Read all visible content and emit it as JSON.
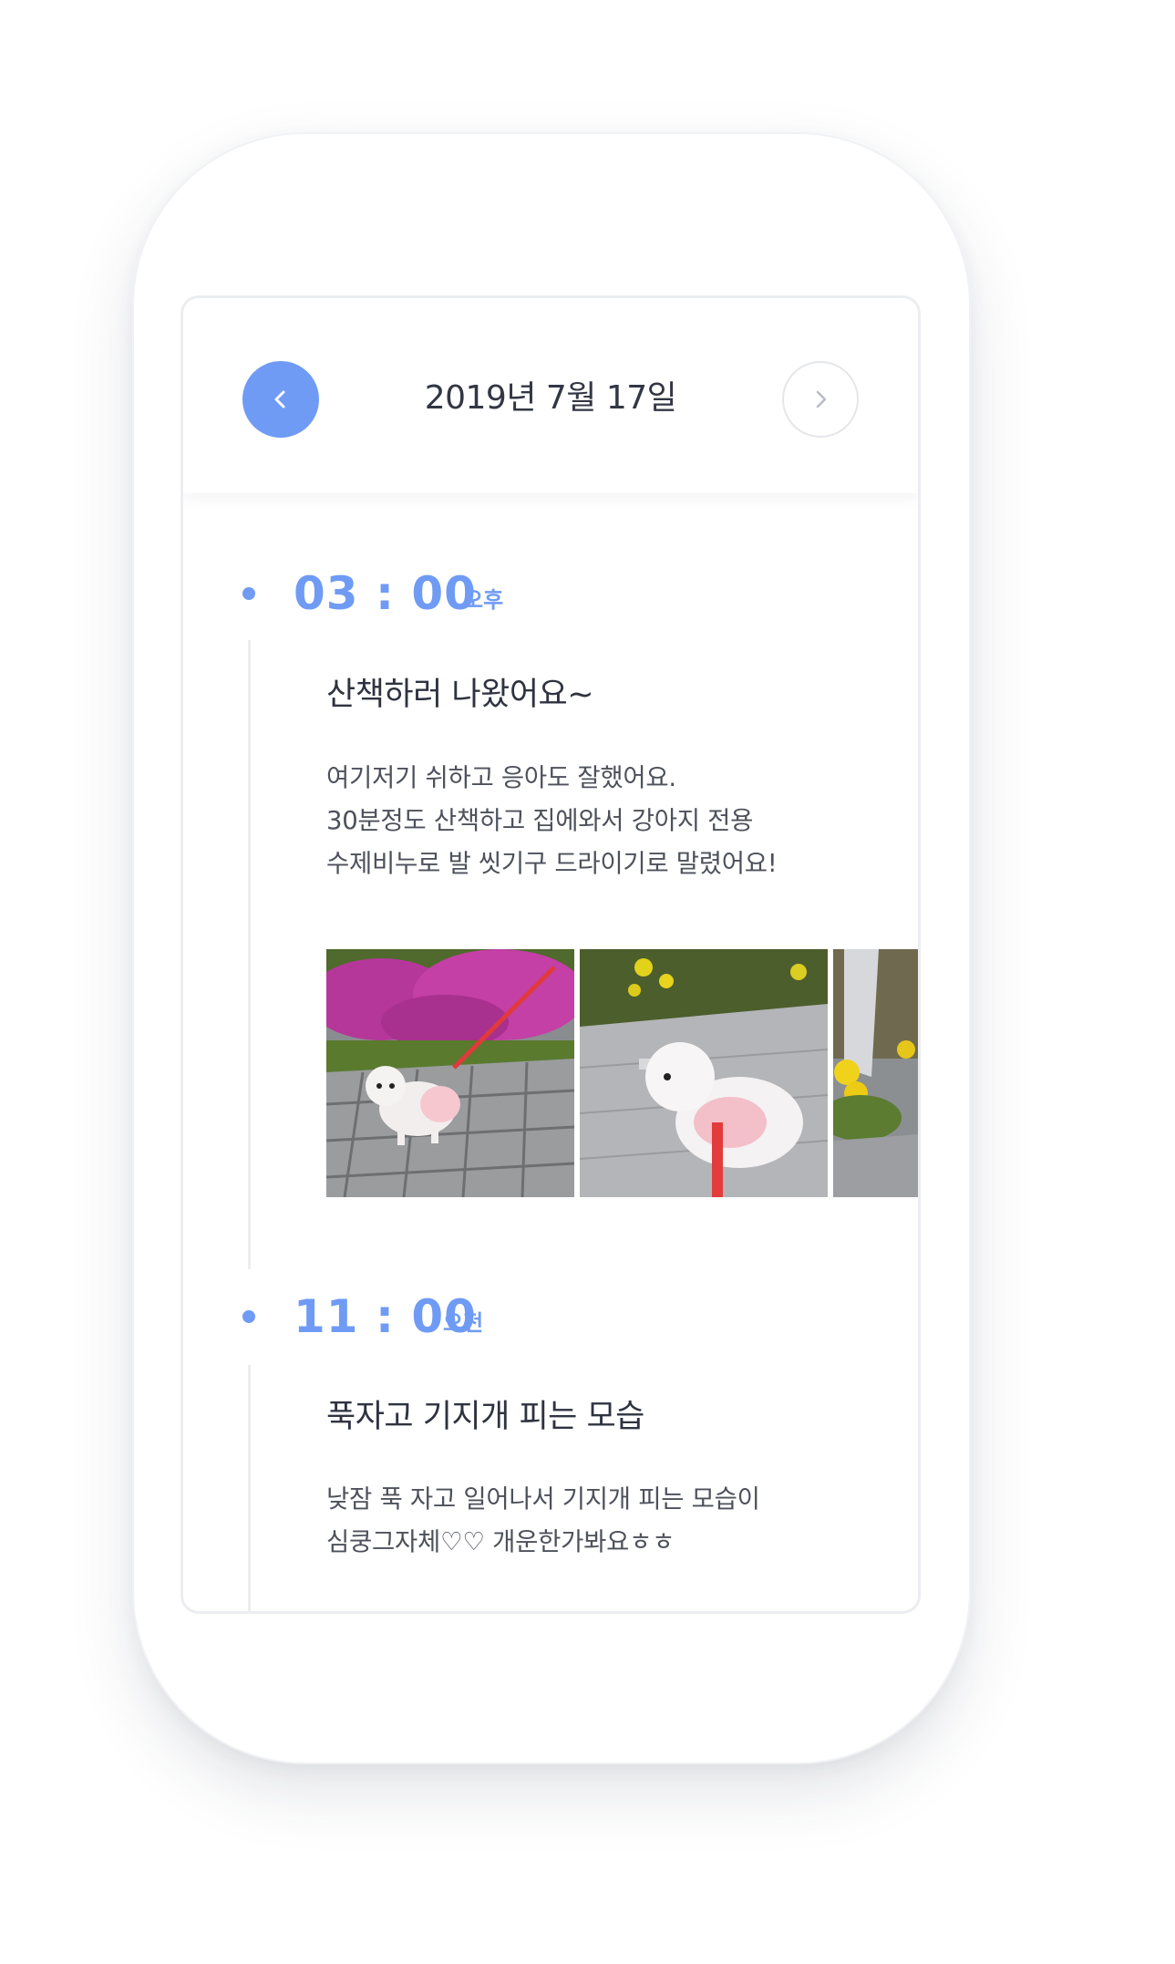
{
  "header": {
    "date": "2019년 7월 17일",
    "prev_icon": "chevron-left-icon",
    "next_icon": "chevron-right-icon"
  },
  "entries": [
    {
      "time": "03 : 00",
      "ampm": "오후",
      "title": "산책하러 나왔어요~",
      "body": [
        "여기저기 쉬하고 응아도 잘했어요.",
        "30분정도 산책하고 집에와서 강아지 전용",
        "수제비누로 발 씻기구 드라이기로 말렸어요!"
      ],
      "photos": [
        "dog-azalea-photo",
        "dog-walkway-photo",
        "flowers-photo"
      ]
    },
    {
      "time": "11 : 00",
      "ampm": "오전",
      "title": "푹자고 기지개 피는 모습",
      "body": [
        "낮잠 푹 자고 일어나서 기지개 피는 모습이",
        "심쿵그자체♡♡ 개운한가봐요ㅎㅎ"
      ]
    }
  ],
  "colors": {
    "accent": "#6f9bf5",
    "text": "#333744",
    "border": "#ebedf0"
  }
}
